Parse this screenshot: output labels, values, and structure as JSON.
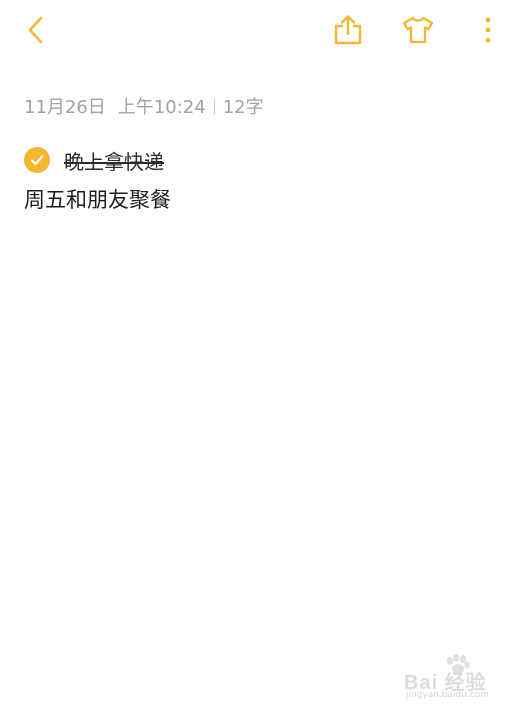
{
  "toolbar": {
    "back_icon": "chevron-left-icon",
    "share_icon": "share-icon",
    "theme_icon": "tshirt-icon",
    "more_icon": "more-vertical-icon",
    "accent_color": "#f5b630"
  },
  "note": {
    "date": "11月26日",
    "time": "上午10:24",
    "char_count": "12字",
    "todo": {
      "text": "晚上拿快递",
      "checked": true
    },
    "body": "周五和朋友聚餐"
  },
  "watermark": {
    "text": "Bai 经验",
    "url": "jingyan.baidu.com"
  }
}
